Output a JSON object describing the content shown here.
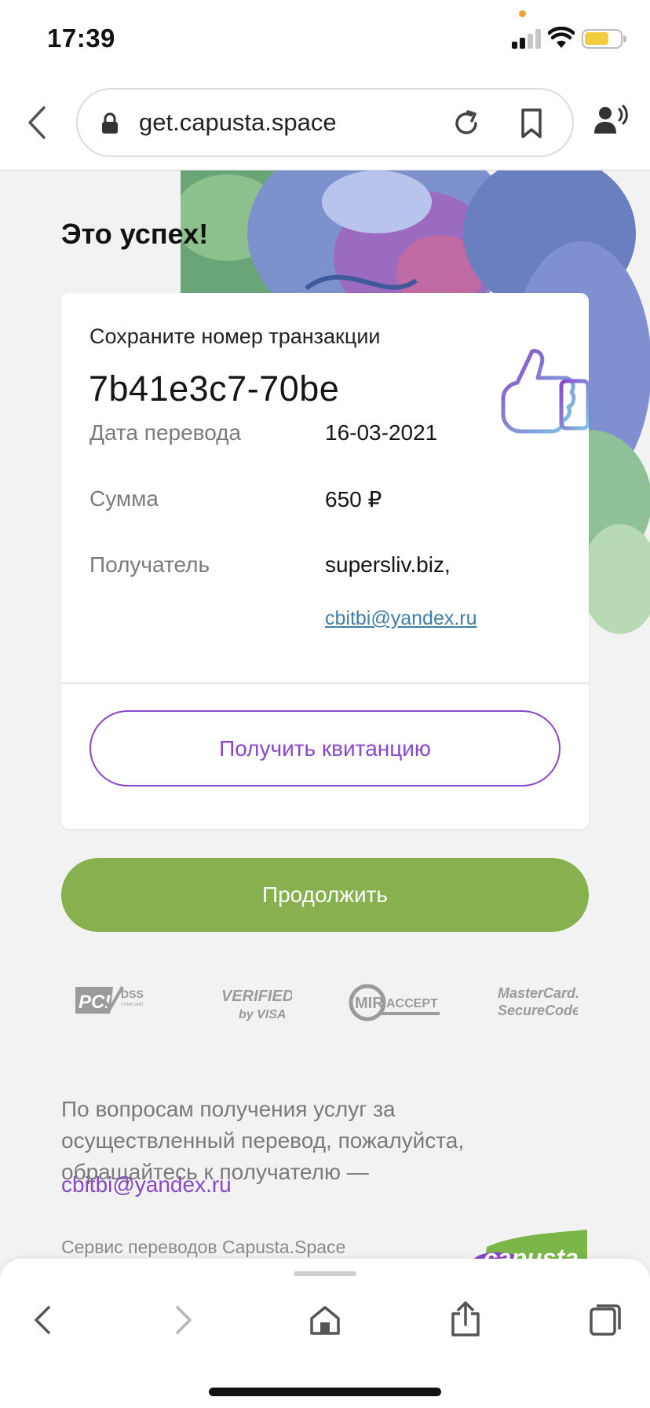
{
  "status_bar": {
    "time": "17:39",
    "icons": [
      "signal-icon",
      "wifi-icon",
      "battery-icon"
    ]
  },
  "browser": {
    "url": "get.capusta.space",
    "icons": [
      "back-icon",
      "lock-icon",
      "reload-icon",
      "bookmark-icon",
      "voice-icon"
    ]
  },
  "page": {
    "title": "Это успех!",
    "card": {
      "caption": "Сохраните номер транзакции",
      "transaction_number": "7b41e3c7-70be",
      "rows": [
        {
          "label": "Дата перевода",
          "value": "16-03-2021"
        },
        {
          "label": "Сумма",
          "value": "650 ₽"
        },
        {
          "label": "Получатель",
          "value": "supersliv.biz,",
          "link": "cbitbi@yandex.ru"
        }
      ],
      "receipt_button": "Получить квитанцию"
    },
    "continue_button": "Продолжить",
    "payment_logos": [
      "PCI DSS",
      "Verified by VISA",
      "MIR ACCEPT",
      "MasterCard. SecureCode."
    ],
    "info_text": "По вопросам получения услуг за осуществленный перевод, пожалуйста, обращайтесь к получателю —",
    "info_email": "cbitbi@yandex.ru",
    "footer_service": "Сервис переводов Capusta.Space",
    "footer_logo": "capusta"
  },
  "toolbar": {
    "icons": [
      "back-icon",
      "forward-icon",
      "home-icon",
      "share-icon",
      "tabs-icon"
    ]
  },
  "colors": {
    "accent_purple": "#8a47c9",
    "accent_green": "#87b14f",
    "link_blue": "#3f7fa5",
    "background": "#f2f2f2"
  }
}
